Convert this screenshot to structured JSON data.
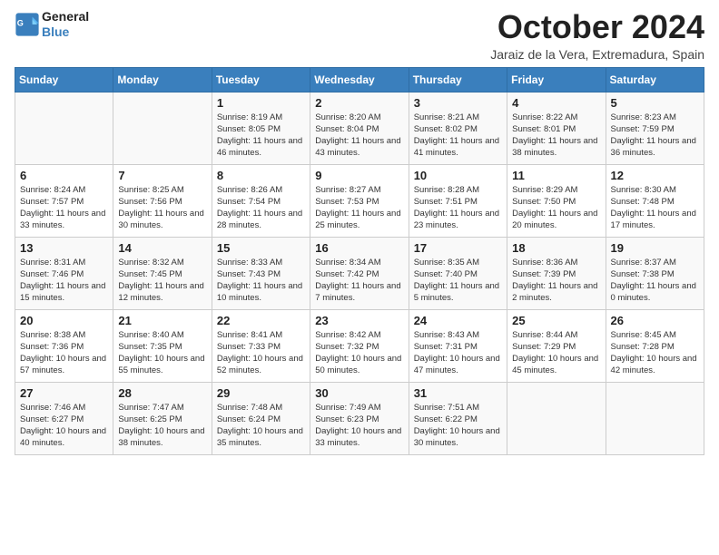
{
  "logo": {
    "line1": "General",
    "line2": "Blue"
  },
  "title": "October 2024",
  "subtitle": "Jaraiz de la Vera, Extremadura, Spain",
  "days_of_week": [
    "Sunday",
    "Monday",
    "Tuesday",
    "Wednesday",
    "Thursday",
    "Friday",
    "Saturday"
  ],
  "weeks": [
    [
      {
        "day": "",
        "info": ""
      },
      {
        "day": "",
        "info": ""
      },
      {
        "day": "1",
        "info": "Sunrise: 8:19 AM\nSunset: 8:05 PM\nDaylight: 11 hours and 46 minutes."
      },
      {
        "day": "2",
        "info": "Sunrise: 8:20 AM\nSunset: 8:04 PM\nDaylight: 11 hours and 43 minutes."
      },
      {
        "day": "3",
        "info": "Sunrise: 8:21 AM\nSunset: 8:02 PM\nDaylight: 11 hours and 41 minutes."
      },
      {
        "day": "4",
        "info": "Sunrise: 8:22 AM\nSunset: 8:01 PM\nDaylight: 11 hours and 38 minutes."
      },
      {
        "day": "5",
        "info": "Sunrise: 8:23 AM\nSunset: 7:59 PM\nDaylight: 11 hours and 36 minutes."
      }
    ],
    [
      {
        "day": "6",
        "info": "Sunrise: 8:24 AM\nSunset: 7:57 PM\nDaylight: 11 hours and 33 minutes."
      },
      {
        "day": "7",
        "info": "Sunrise: 8:25 AM\nSunset: 7:56 PM\nDaylight: 11 hours and 30 minutes."
      },
      {
        "day": "8",
        "info": "Sunrise: 8:26 AM\nSunset: 7:54 PM\nDaylight: 11 hours and 28 minutes."
      },
      {
        "day": "9",
        "info": "Sunrise: 8:27 AM\nSunset: 7:53 PM\nDaylight: 11 hours and 25 minutes."
      },
      {
        "day": "10",
        "info": "Sunrise: 8:28 AM\nSunset: 7:51 PM\nDaylight: 11 hours and 23 minutes."
      },
      {
        "day": "11",
        "info": "Sunrise: 8:29 AM\nSunset: 7:50 PM\nDaylight: 11 hours and 20 minutes."
      },
      {
        "day": "12",
        "info": "Sunrise: 8:30 AM\nSunset: 7:48 PM\nDaylight: 11 hours and 17 minutes."
      }
    ],
    [
      {
        "day": "13",
        "info": "Sunrise: 8:31 AM\nSunset: 7:46 PM\nDaylight: 11 hours and 15 minutes."
      },
      {
        "day": "14",
        "info": "Sunrise: 8:32 AM\nSunset: 7:45 PM\nDaylight: 11 hours and 12 minutes."
      },
      {
        "day": "15",
        "info": "Sunrise: 8:33 AM\nSunset: 7:43 PM\nDaylight: 11 hours and 10 minutes."
      },
      {
        "day": "16",
        "info": "Sunrise: 8:34 AM\nSunset: 7:42 PM\nDaylight: 11 hours and 7 minutes."
      },
      {
        "day": "17",
        "info": "Sunrise: 8:35 AM\nSunset: 7:40 PM\nDaylight: 11 hours and 5 minutes."
      },
      {
        "day": "18",
        "info": "Sunrise: 8:36 AM\nSunset: 7:39 PM\nDaylight: 11 hours and 2 minutes."
      },
      {
        "day": "19",
        "info": "Sunrise: 8:37 AM\nSunset: 7:38 PM\nDaylight: 11 hours and 0 minutes."
      }
    ],
    [
      {
        "day": "20",
        "info": "Sunrise: 8:38 AM\nSunset: 7:36 PM\nDaylight: 10 hours and 57 minutes."
      },
      {
        "day": "21",
        "info": "Sunrise: 8:40 AM\nSunset: 7:35 PM\nDaylight: 10 hours and 55 minutes."
      },
      {
        "day": "22",
        "info": "Sunrise: 8:41 AM\nSunset: 7:33 PM\nDaylight: 10 hours and 52 minutes."
      },
      {
        "day": "23",
        "info": "Sunrise: 8:42 AM\nSunset: 7:32 PM\nDaylight: 10 hours and 50 minutes."
      },
      {
        "day": "24",
        "info": "Sunrise: 8:43 AM\nSunset: 7:31 PM\nDaylight: 10 hours and 47 minutes."
      },
      {
        "day": "25",
        "info": "Sunrise: 8:44 AM\nSunset: 7:29 PM\nDaylight: 10 hours and 45 minutes."
      },
      {
        "day": "26",
        "info": "Sunrise: 8:45 AM\nSunset: 7:28 PM\nDaylight: 10 hours and 42 minutes."
      }
    ],
    [
      {
        "day": "27",
        "info": "Sunrise: 7:46 AM\nSunset: 6:27 PM\nDaylight: 10 hours and 40 minutes."
      },
      {
        "day": "28",
        "info": "Sunrise: 7:47 AM\nSunset: 6:25 PM\nDaylight: 10 hours and 38 minutes."
      },
      {
        "day": "29",
        "info": "Sunrise: 7:48 AM\nSunset: 6:24 PM\nDaylight: 10 hours and 35 minutes."
      },
      {
        "day": "30",
        "info": "Sunrise: 7:49 AM\nSunset: 6:23 PM\nDaylight: 10 hours and 33 minutes."
      },
      {
        "day": "31",
        "info": "Sunrise: 7:51 AM\nSunset: 6:22 PM\nDaylight: 10 hours and 30 minutes."
      },
      {
        "day": "",
        "info": ""
      },
      {
        "day": "",
        "info": ""
      }
    ]
  ]
}
